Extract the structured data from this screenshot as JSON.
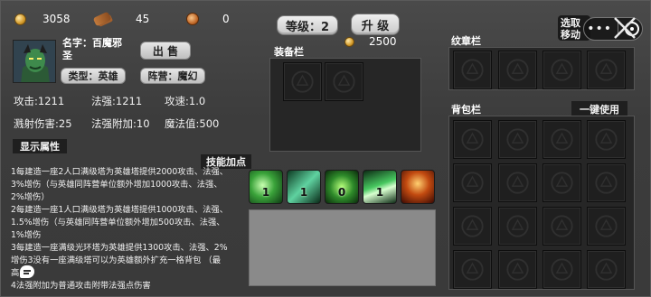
{
  "resources": {
    "gold": "3058",
    "wood": "45",
    "gem": "0"
  },
  "level": {
    "label": "等级：2",
    "upgrade_button": "升 级",
    "upgrade_cost": "2500"
  },
  "select_move_button": "选取\n移动",
  "hero": {
    "name": "名字：百魔邪圣",
    "name_line1": "名字：百魔邪",
    "name_line2": "圣",
    "sell_button": "出 售",
    "type": "类型：英雄",
    "faction": "阵营：魔幻"
  },
  "stats": {
    "attack": "攻击:1211",
    "spell_power": "法强:1211",
    "attack_speed": "攻速:1.0",
    "splash": "溅射伤害:25",
    "spell_bonus": "法强附加:10",
    "mana": "魔法值:500"
  },
  "show_attributes": "显示属性",
  "skills_title": "技能加点",
  "skills": [
    {
      "name": "skill-1",
      "level": "1"
    },
    {
      "name": "skill-2",
      "level": "1"
    },
    {
      "name": "skill-3",
      "level": "0"
    },
    {
      "name": "skill-4",
      "level": "1"
    },
    {
      "name": "skill-5",
      "level": ""
    }
  ],
  "description_lines": [
    "1每建造一座2人口满级塔为英雄塔提供2000攻击、法强、",
    "3%增伤（与英雄同阵营单位额外增加1000攻击、法强、",
    "2%增伤）",
    "2每建造一座1人口满级塔为英雄塔提供1000攻击、法强、",
    "1.5%增伤（与英雄同阵营单位额外增加500攻击、法强、",
    "1%增伤",
    "3每建造一座满级光环塔为英雄提供1300攻击、法强、2%",
    "增伤3没有一座满级塔可以为英雄额外扩充一格背包 （最",
    "高",
    "4法强附加为普通攻击附带法强点伤害"
  ],
  "equipment_title": "装备栏",
  "emblem_title": "纹章栏",
  "backpack_title": "背包栏",
  "use_all_button": "一键使用",
  "colors": {
    "background": "#3a3a3a",
    "panel": "#262626",
    "slot": "#1f1f1f",
    "button": "#e0e0e0"
  }
}
